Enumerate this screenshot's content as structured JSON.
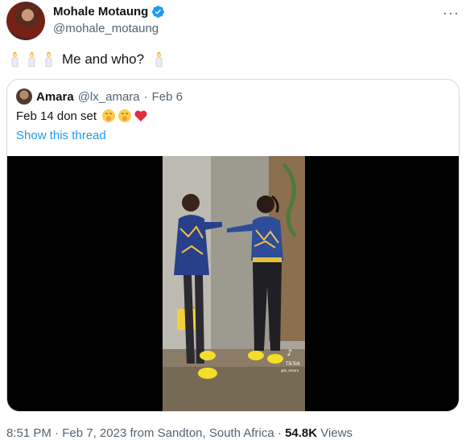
{
  "author": {
    "display_name": "Mohale Motaung",
    "handle": "@mohale_motaung",
    "verified_color": "#1d9bf0"
  },
  "tweet": {
    "text": "Me and who?",
    "leading_emoji": [
      "candle-emoji",
      "candle-emoji",
      "candle-emoji"
    ],
    "trailing_emoji": [
      "candle-emoji"
    ]
  },
  "quoted": {
    "display_name": "Amara",
    "handle": "@lx_amara",
    "separator": "·",
    "date": "Feb 6",
    "text": "Feb 14 don set",
    "emoji": [
      "shushing-face-emoji",
      "shushing-face-emoji",
      "red-heart-emoji"
    ],
    "show_thread_label": "Show this thread",
    "media": {
      "watermark": "TikTok",
      "watermark_handle": "@lx_amara"
    }
  },
  "footer": {
    "time": "8:51 PM",
    "date": "Feb 7, 2023",
    "location_prefix": "from",
    "location": "Sandton, South Africa",
    "separator": "·",
    "views_count": "54.8K",
    "views_label": "Views"
  },
  "colors": {
    "link": "#1d9bf0",
    "secondary_text": "#536471",
    "primary_text": "#0f1419",
    "border": "#cfd9de"
  }
}
